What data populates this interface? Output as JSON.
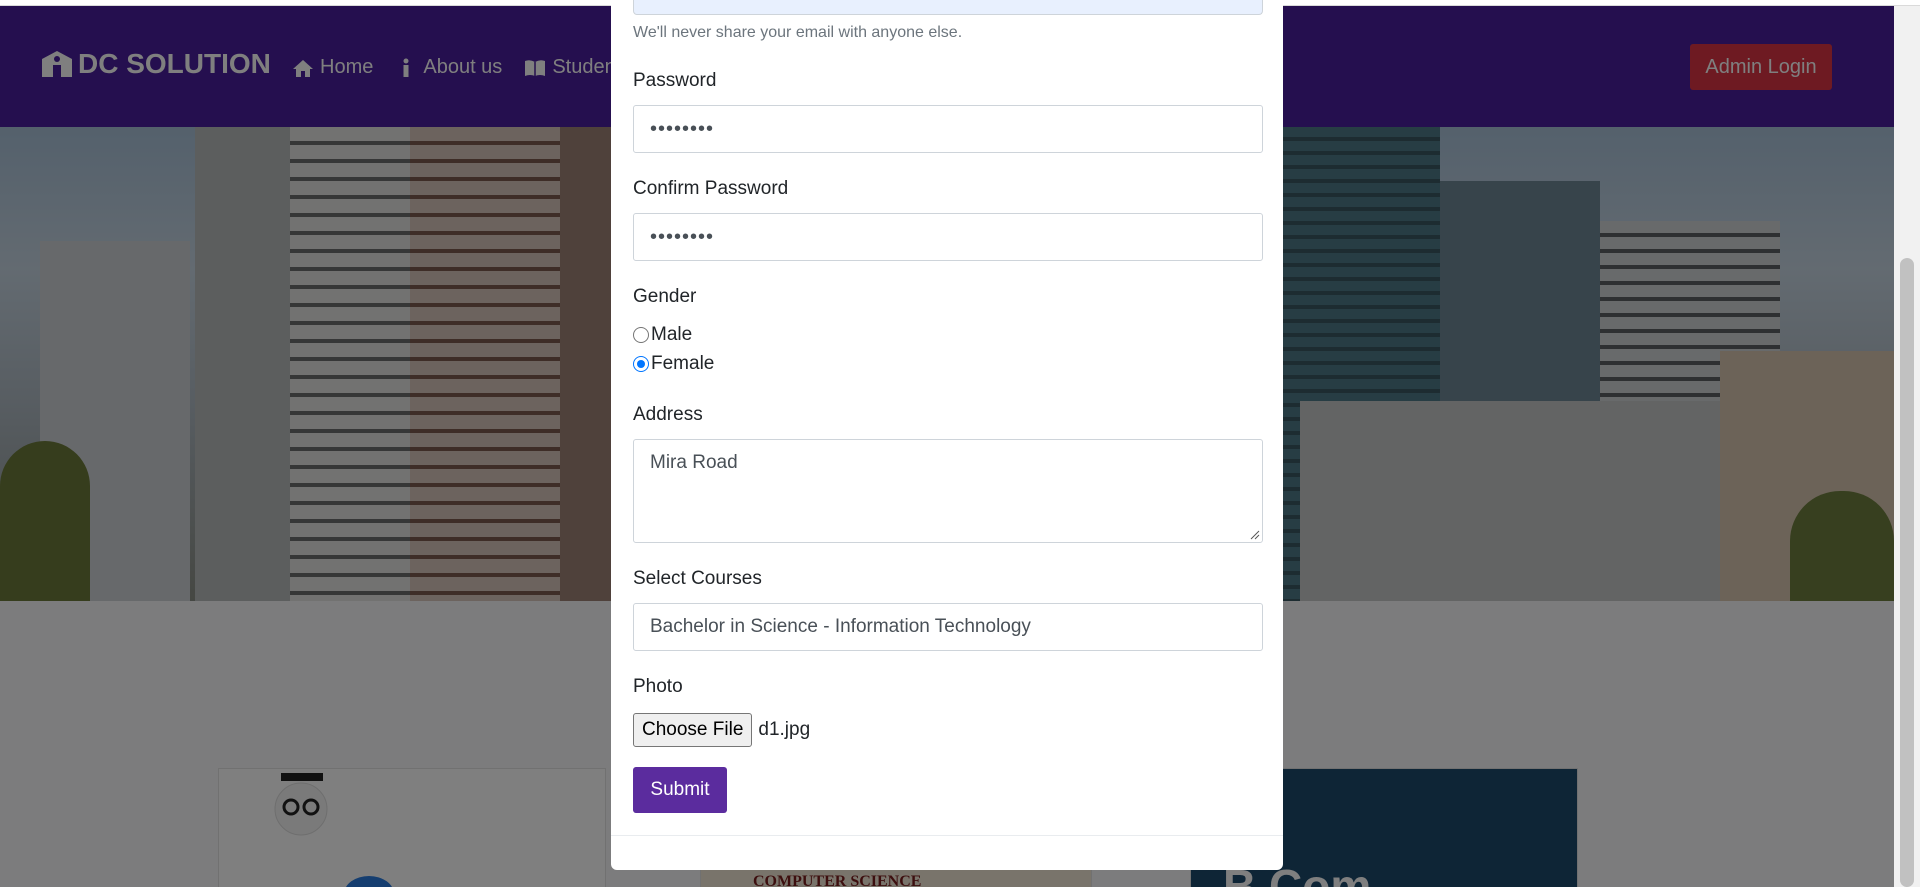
{
  "nav": {
    "brand": "DC SOLUTION",
    "items": [
      {
        "label": "Home",
        "icon": "home-icon"
      },
      {
        "label": "About us",
        "icon": "info-icon"
      },
      {
        "label": "Student C",
        "icon": "book-icon"
      }
    ],
    "admin_label": "Admin Login"
  },
  "cards": {
    "card2_caption": "COMPUTER SCIENCE",
    "card3_caption": "B.Com"
  },
  "form": {
    "email_help": "We'll never share your email with anyone else.",
    "password_label": "Password",
    "password_value": "••••••••",
    "confirm_label": "Confirm Password",
    "confirm_value": "••••••••",
    "gender_label": "Gender",
    "gender_options": [
      {
        "label": "Male",
        "checked": false
      },
      {
        "label": "Female",
        "checked": true
      }
    ],
    "address_label": "Address",
    "address_value": "Mira Road",
    "courses_label": "Select Courses",
    "course_selected": "Bachelor in Science - Information Technology",
    "photo_label": "Photo",
    "file_button": "Choose File",
    "file_name": "d1.jpg",
    "submit_label": "Submit"
  },
  "colors": {
    "navbar": "#4a1e9e",
    "admin_button": "#dc3545",
    "submit_button": "#5b2c9e",
    "radio_checked": "#0075ff"
  }
}
